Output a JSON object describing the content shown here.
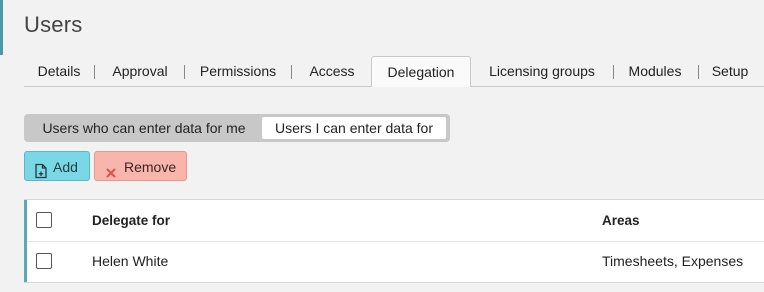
{
  "page": {
    "title": "Users"
  },
  "tabs": [
    {
      "label": "Details",
      "active": false
    },
    {
      "label": "Approval",
      "active": false
    },
    {
      "label": "Permissions",
      "active": false
    },
    {
      "label": "Access",
      "active": false
    },
    {
      "label": "Delegation",
      "active": true
    },
    {
      "label": "Licensing groups",
      "active": false
    },
    {
      "label": "Modules",
      "active": false
    },
    {
      "label": "Setup",
      "active": false
    }
  ],
  "segmented": {
    "options": [
      "Users who can enter data for me",
      "Users I can enter data for"
    ],
    "selected_index": 1
  },
  "toolbar": {
    "add_label": "Add",
    "remove_label": "Remove"
  },
  "table": {
    "columns": [
      "Delegate for",
      "Areas"
    ],
    "rows": [
      {
        "delegate_for": "Helen White",
        "areas": "Timesheets, Expenses",
        "checked": false
      }
    ]
  },
  "colors": {
    "accent": "#4a9aa6",
    "add_button": "#7ad8e6",
    "remove_button": "#f7b5ab",
    "remove_icon": "#d9534f"
  },
  "icons": {
    "add": "file-plus-icon",
    "remove": "close-icon"
  }
}
